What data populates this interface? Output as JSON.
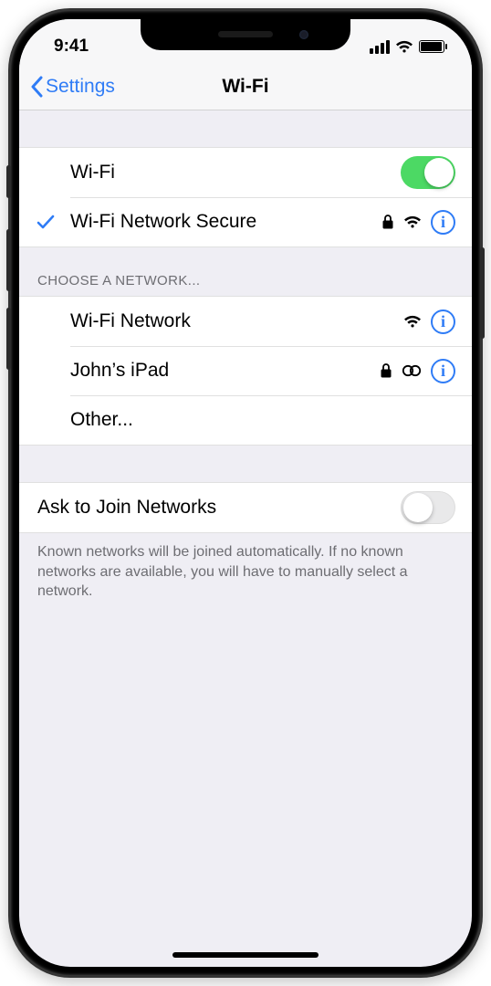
{
  "status": {
    "time": "9:41"
  },
  "nav": {
    "back": "Settings",
    "title": "Wi-Fi"
  },
  "wifi": {
    "label": "Wi-Fi",
    "enabled": true,
    "connected": {
      "name": "Wi-Fi Network Secure",
      "secure": true
    }
  },
  "choose_header": "CHOOSE A NETWORK...",
  "networks": [
    {
      "name": "Wi-Fi Network",
      "secure": false,
      "hotspot": false
    },
    {
      "name": "John’s iPad",
      "secure": true,
      "hotspot": true
    }
  ],
  "other_label": "Other...",
  "ask": {
    "label": "Ask to Join Networks",
    "enabled": false,
    "footer": "Known networks will be joined automatically. If no known networks are available, you will have to manually select a network."
  }
}
